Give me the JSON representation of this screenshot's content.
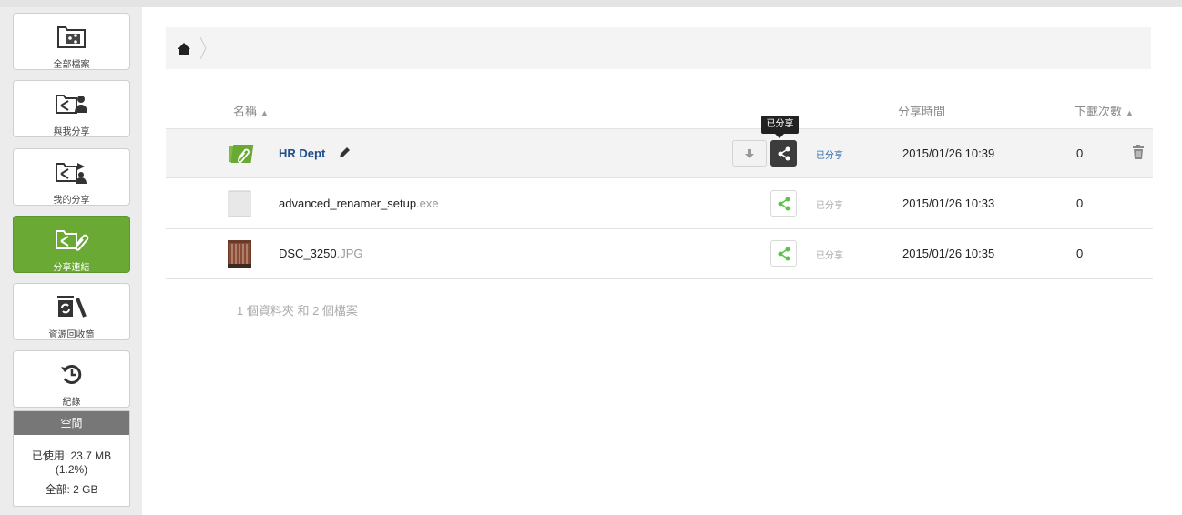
{
  "sidebar": {
    "items": [
      {
        "label": "全部檔案",
        "icon": "all-files-icon"
      },
      {
        "label": "與我分享",
        "icon": "shared-with-me-icon"
      },
      {
        "label": "我的分享",
        "icon": "my-shares-icon"
      },
      {
        "label": "分享連結",
        "icon": "share-link-icon",
        "active": true
      },
      {
        "label": "資源回收筒",
        "icon": "recycle-bin-icon"
      },
      {
        "label": "紀錄",
        "icon": "history-icon"
      }
    ],
    "storage": {
      "title": "空間",
      "used_line1": "已使用: 23.7 MB",
      "used_line2": "(1.2%)",
      "total": "全部: 2 GB"
    }
  },
  "table": {
    "headers": {
      "name": "名稱",
      "share_time": "分享時間",
      "downloads": "下載次數"
    },
    "rows": [
      {
        "name": "HR Dept",
        "ext": "",
        "type": "folder",
        "shared": "已分享",
        "date": "2015/01/26 10:39",
        "downloads": "0"
      },
      {
        "name": "advanced_renamer_setup",
        "ext": ".exe",
        "type": "file",
        "shared": "已分享",
        "date": "2015/01/26 10:33",
        "downloads": "0"
      },
      {
        "name": "DSC_3250",
        "ext": ".JPG",
        "type": "image",
        "shared": "已分享",
        "date": "2015/01/26 10:35",
        "downloads": "0"
      }
    ],
    "summary": "1 個資料夾 和 2 個檔案"
  },
  "tooltip": "已分享",
  "colors": {
    "accent": "#6aaa34",
    "share_green": "#5cc24a",
    "link_blue": "#2f6aa8"
  }
}
